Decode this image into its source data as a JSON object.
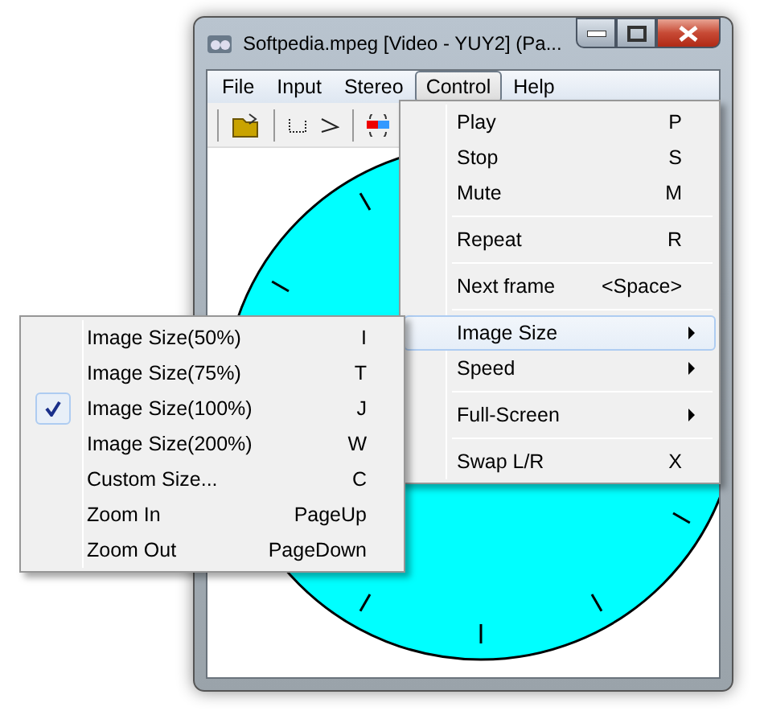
{
  "window": {
    "title": "Softpedia.mpeg [Video - YUY2] (Pa..."
  },
  "menubar": [
    {
      "label": "File",
      "selected": false
    },
    {
      "label": "Input",
      "selected": false
    },
    {
      "label": "Stereo",
      "selected": false
    },
    {
      "label": "Control",
      "selected": true
    },
    {
      "label": "Help",
      "selected": false
    }
  ],
  "control_menu": [
    {
      "kind": "item",
      "label": "Play",
      "shortcut": "P",
      "selected": false
    },
    {
      "kind": "item",
      "label": "Stop",
      "shortcut": "S",
      "selected": false
    },
    {
      "kind": "item",
      "label": "Mute",
      "shortcut": "M",
      "selected": false
    },
    {
      "kind": "separator"
    },
    {
      "kind": "item",
      "label": "Repeat",
      "shortcut": "R",
      "selected": false
    },
    {
      "kind": "separator"
    },
    {
      "kind": "item",
      "label": "Next frame",
      "shortcut": "<Space>",
      "selected": false
    },
    {
      "kind": "separator"
    },
    {
      "kind": "submenu",
      "label": "Image Size",
      "selected": true
    },
    {
      "kind": "submenu",
      "label": "Speed",
      "selected": false
    },
    {
      "kind": "separator"
    },
    {
      "kind": "submenu",
      "label": "Full-Screen",
      "selected": false
    },
    {
      "kind": "separator"
    },
    {
      "kind": "item",
      "label": "Swap L/R",
      "shortcut": "X",
      "selected": false
    }
  ],
  "image_size_menu": [
    {
      "label": "Image Size(50%)",
      "shortcut": "I",
      "checked": false
    },
    {
      "label": "Image Size(75%)",
      "shortcut": "T",
      "checked": false
    },
    {
      "label": "Image Size(100%)",
      "shortcut": "J",
      "checked": true
    },
    {
      "label": "Image Size(200%)",
      "shortcut": "W",
      "checked": false
    },
    {
      "label": "Custom Size...",
      "shortcut": "C",
      "checked": false
    },
    {
      "label": "Zoom In",
      "shortcut": "PageUp",
      "checked": false
    },
    {
      "label": "Zoom Out",
      "shortcut": "PageDown",
      "checked": false
    }
  ]
}
